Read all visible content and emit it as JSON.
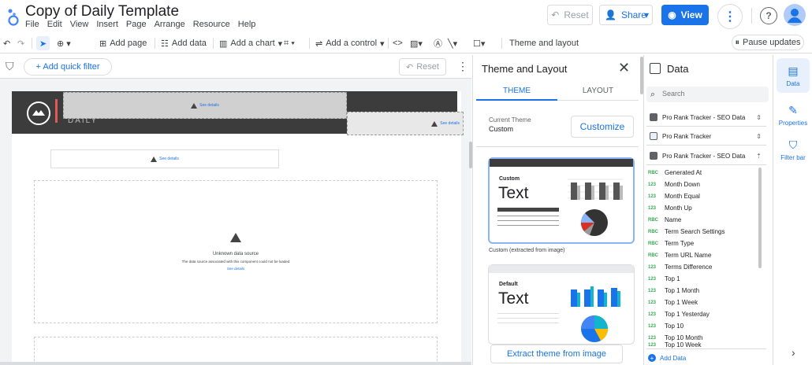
{
  "header": {
    "title": "Copy of Daily Template",
    "menu": [
      "File",
      "Edit",
      "View",
      "Insert",
      "Page",
      "Arrange",
      "Resource",
      "Help"
    ],
    "reset_label": "Reset",
    "share_label": "Share",
    "view_label": "View"
  },
  "toolbar": {
    "add_page": "Add page",
    "add_data": "Add data",
    "add_chart": "Add a chart",
    "add_control": "Add a control",
    "theme_layout": "Theme and layout",
    "pause": "Pause updates"
  },
  "canvas": {
    "quick_filter": "+ Add quick filter",
    "reset_label": "Reset",
    "daily": "DAILY",
    "see_details": "See details",
    "error_title": "Unknown data source",
    "error_body": "The data source associated with this component could not be loaded",
    "error_link": "See details"
  },
  "theme_panel": {
    "title": "Theme and Layout",
    "tabs": [
      "THEME",
      "LAYOUT"
    ],
    "current_label": "Current Theme",
    "current_value": "Custom",
    "customize": "Customize",
    "card1_label": "Custom",
    "card1_text": "Text",
    "card1_caption": "Custom (extracted from image)",
    "card2_label": "Default",
    "card2_text": "Text",
    "extract": "Extract theme from image"
  },
  "data_panel": {
    "title": "Data",
    "search_placeholder": "Search",
    "sources": [
      "Pro Rank Tracker - SEO Data",
      "Pro Rank Tracker",
      "Pro Rank Tracker - SEO Data"
    ],
    "fields": [
      {
        "type": "RBC",
        "name": "Generated At"
      },
      {
        "type": "123",
        "name": "Month Down"
      },
      {
        "type": "123",
        "name": "Month Equal"
      },
      {
        "type": "123",
        "name": "Month Up"
      },
      {
        "type": "RBC",
        "name": "Name"
      },
      {
        "type": "RBC",
        "name": "Term Search Settings"
      },
      {
        "type": "RBC",
        "name": "Term Type"
      },
      {
        "type": "RBC",
        "name": "Term URL Name"
      },
      {
        "type": "123",
        "name": "Terms Difference"
      },
      {
        "type": "123",
        "name": "Top 1"
      },
      {
        "type": "123",
        "name": "Top 1 Month"
      },
      {
        "type": "123",
        "name": "Top 1 Week"
      },
      {
        "type": "123",
        "name": "Top 1 Yesterday"
      },
      {
        "type": "123",
        "name": "Top 10"
      },
      {
        "type": "123",
        "name": "Top 10 Month"
      },
      {
        "type": "123",
        "name": "Top 10 Week"
      }
    ],
    "add_data": "Add Data"
  },
  "rail": {
    "data": "Data",
    "properties": "Properties",
    "filter": "Filter bar"
  },
  "colors": {
    "accent": "#1a73e8",
    "banner": "#3c3c3c"
  }
}
